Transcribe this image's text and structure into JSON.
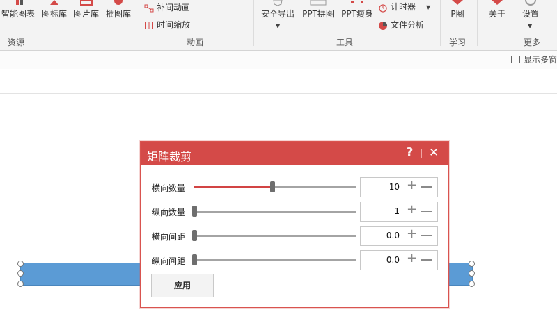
{
  "ribbon": {
    "resources": {
      "items": [
        "智能图表",
        "图标库",
        "图片库",
        "插图库"
      ],
      "label": "资源"
    },
    "animation": {
      "items": [
        "补间动画",
        "时间缩放"
      ],
      "label": "动画"
    },
    "tools": {
      "items": [
        "安全导出",
        "PPT拼图",
        "PPT瘦身",
        "计时器",
        "文件分析"
      ],
      "label": "工具"
    },
    "learn": {
      "items": [
        "P圈"
      ],
      "label": "学习"
    },
    "more": {
      "items": [
        "关于",
        "设置"
      ],
      "label": "更多"
    }
  },
  "toolbar2": {
    "multi_window": "显示多窗"
  },
  "dialog": {
    "title": "矩阵裁剪",
    "help_icon": "help-icon",
    "close_icon": "close-icon",
    "rows": [
      {
        "label": "横向数量",
        "value": "10",
        "slider_fraction": 0.48
      },
      {
        "label": "纵向数量",
        "value": "1",
        "slider_fraction": 0.0
      },
      {
        "label": "横向间距",
        "value": "0.0",
        "slider_fraction": 0.0
      },
      {
        "label": "纵向间距",
        "value": "0.0",
        "slider_fraction": 0.0
      }
    ],
    "apply_label": "应用"
  },
  "colors": {
    "accent": "#d44a48",
    "shape_fill": "#5b9bd5",
    "slider_fill": "#d24444"
  }
}
